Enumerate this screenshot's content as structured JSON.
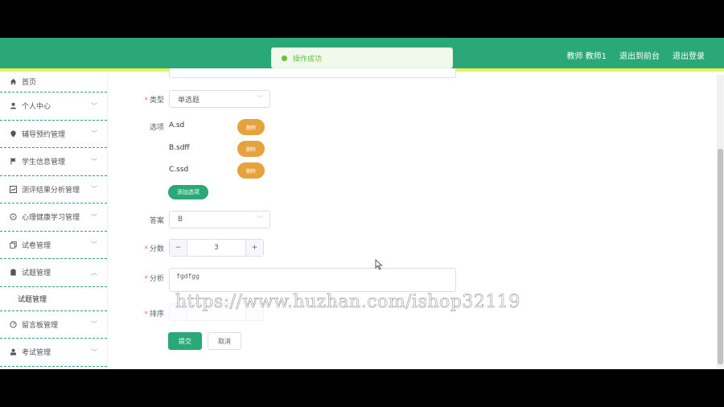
{
  "header": {
    "user": "教师 教师1",
    "to_front": "退出到前台",
    "logout": "退出登录"
  },
  "toast": {
    "message": "操作成功"
  },
  "sidebar": {
    "items": [
      {
        "label": "首页",
        "icon": "home-icon"
      },
      {
        "label": "个人中心",
        "icon": "user-icon"
      },
      {
        "label": "辅导预约管理",
        "icon": "location-icon"
      },
      {
        "label": "学生信息管理",
        "icon": "flag-icon"
      },
      {
        "label": "测评结果分析管理",
        "icon": "chart-icon"
      },
      {
        "label": "心理健康学习管理",
        "icon": "compass-icon"
      },
      {
        "label": "试卷管理",
        "icon": "copy-icon"
      },
      {
        "label": "试题管理",
        "icon": "clipboard-icon"
      },
      {
        "label": "留言板管理",
        "icon": "dashboard-icon"
      },
      {
        "label": "考试管理",
        "icon": "user-solid-icon"
      }
    ],
    "sub_item": "试题管理"
  },
  "form": {
    "type_label": "类型",
    "type_value": "单选题",
    "options_label": "选项",
    "options": [
      "A.sd",
      "B.sdff",
      "C.ssd"
    ],
    "delete_label": "删除",
    "add_option_label": "添加选项",
    "answer_label": "答案",
    "answer_value": "B",
    "score_label": "分数",
    "score_value": "3",
    "minus": "−",
    "plus": "+",
    "analysis_label": "分析",
    "analysis_value": "fgdfgg",
    "order_label": "排序",
    "submit_label": "提交",
    "cancel_label": "取消"
  },
  "watermark": "https://www.huzhan.com/ishop32119",
  "colors": {
    "primary": "#2aa878",
    "header_border": "#e9ef5e",
    "danger": "#e6a23c"
  }
}
